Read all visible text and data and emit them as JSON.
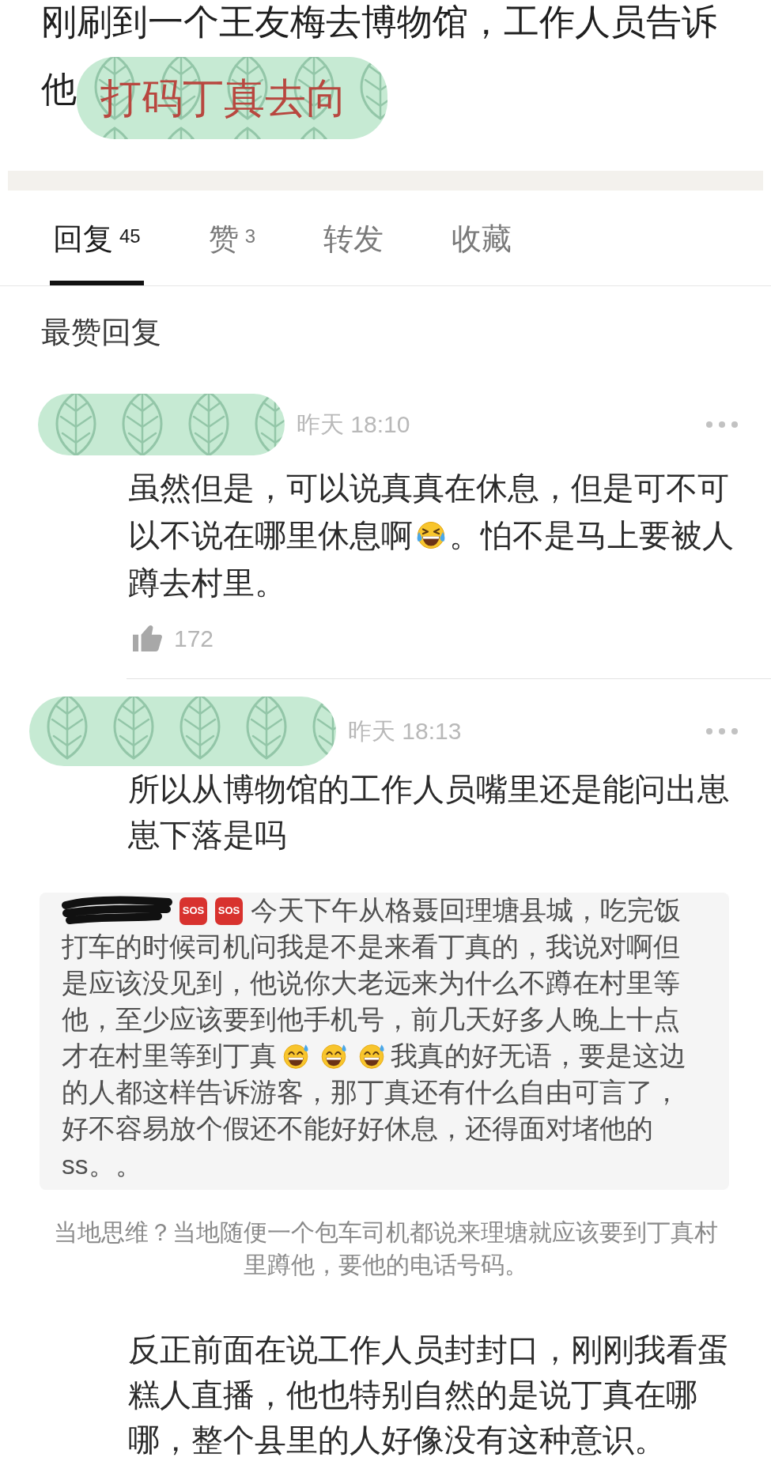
{
  "post": {
    "lines": [
      [
        {
          "kind": "text",
          "text": "刚刷到一个王友梅去博物馆，工作人员告诉"
        }
      ],
      [
        {
          "kind": "text",
          "text": "他"
        },
        {
          "kind": "sticker",
          "text": "打码丁真去向"
        }
      ]
    ]
  },
  "tabs": [
    {
      "label": "回复",
      "count": "45",
      "selected": true
    },
    {
      "label": "赞",
      "count": "3",
      "selected": false
    },
    {
      "label": "转发",
      "selected": false
    },
    {
      "label": "收藏",
      "selected": false
    }
  ],
  "section_title": "最赞回复",
  "comments": [
    {
      "time": "昨天 18:10",
      "content": [
        {
          "kind": "lines",
          "lines": [
            [
              {
                "kind": "text",
                "text": "虽然但是，可以说真真在休息，但是可不可"
              }
            ],
            [
              {
                "kind": "text",
                "text": "以不说在哪里休息啊"
              },
              {
                "kind": "laughcry"
              },
              {
                "kind": "text",
                "text": "。怕不是马上要被人"
              }
            ],
            [
              {
                "kind": "text",
                "text": "蹲去村里。"
              }
            ]
          ]
        }
      ],
      "likes": "172"
    },
    {
      "time": "昨天 18:13",
      "content": [
        {
          "kind": "paragraph",
          "text": "所以从博物馆的工作人员嘴里还是能问出崽崽下落是吗"
        },
        {
          "kind": "screenshot",
          "lines": [
            [
              {
                "kind": "scribble"
              },
              {
                "kind": "sos",
                "text": "SOS"
              },
              {
                "kind": "sos",
                "text": "SOS"
              },
              {
                "kind": "text",
                "text": "今天下午从格聂回理塘县城，吃完饭"
              }
            ],
            [
              {
                "kind": "text",
                "text": "打车的时候司机问我是不是来看丁真的，我说对啊但"
              }
            ],
            [
              {
                "kind": "text",
                "text": "是应该没见到，他说你大老远来为什么不蹲在村里等"
              }
            ],
            [
              {
                "kind": "text",
                "text": "他，至少应该要到他手机号，前几天好多人晚上十点"
              }
            ],
            [
              {
                "kind": "text",
                "text": "才在村里等到丁真"
              },
              {
                "kind": "sweatsmile"
              },
              {
                "kind": "sweatsmile"
              },
              {
                "kind": "sweatsmile"
              },
              {
                "kind": "text",
                "text": "我真的好无语，要是这边"
              }
            ],
            [
              {
                "kind": "text",
                "text": "的人都这样告诉游客，那丁真还有什么自由可言了，"
              }
            ],
            [
              {
                "kind": "text",
                "text": "好不容易放个假还不能好好休息，还得面对堵他的"
              }
            ],
            [
              {
                "kind": "text",
                "text": "ss。。"
              }
            ]
          ]
        },
        {
          "kind": "caption",
          "text": "当地思维？当地随便一个包车司机都说来理塘就应该要到丁真村里蹲他，要他的电话号码。"
        },
        {
          "kind": "paragraph",
          "text": "反正前面在说工作人员封封口，刚刚我看蛋糕人直播，他也特别自然的是说丁真在哪哪，整个县里的人好像没有这种意识。"
        }
      ]
    }
  ]
}
